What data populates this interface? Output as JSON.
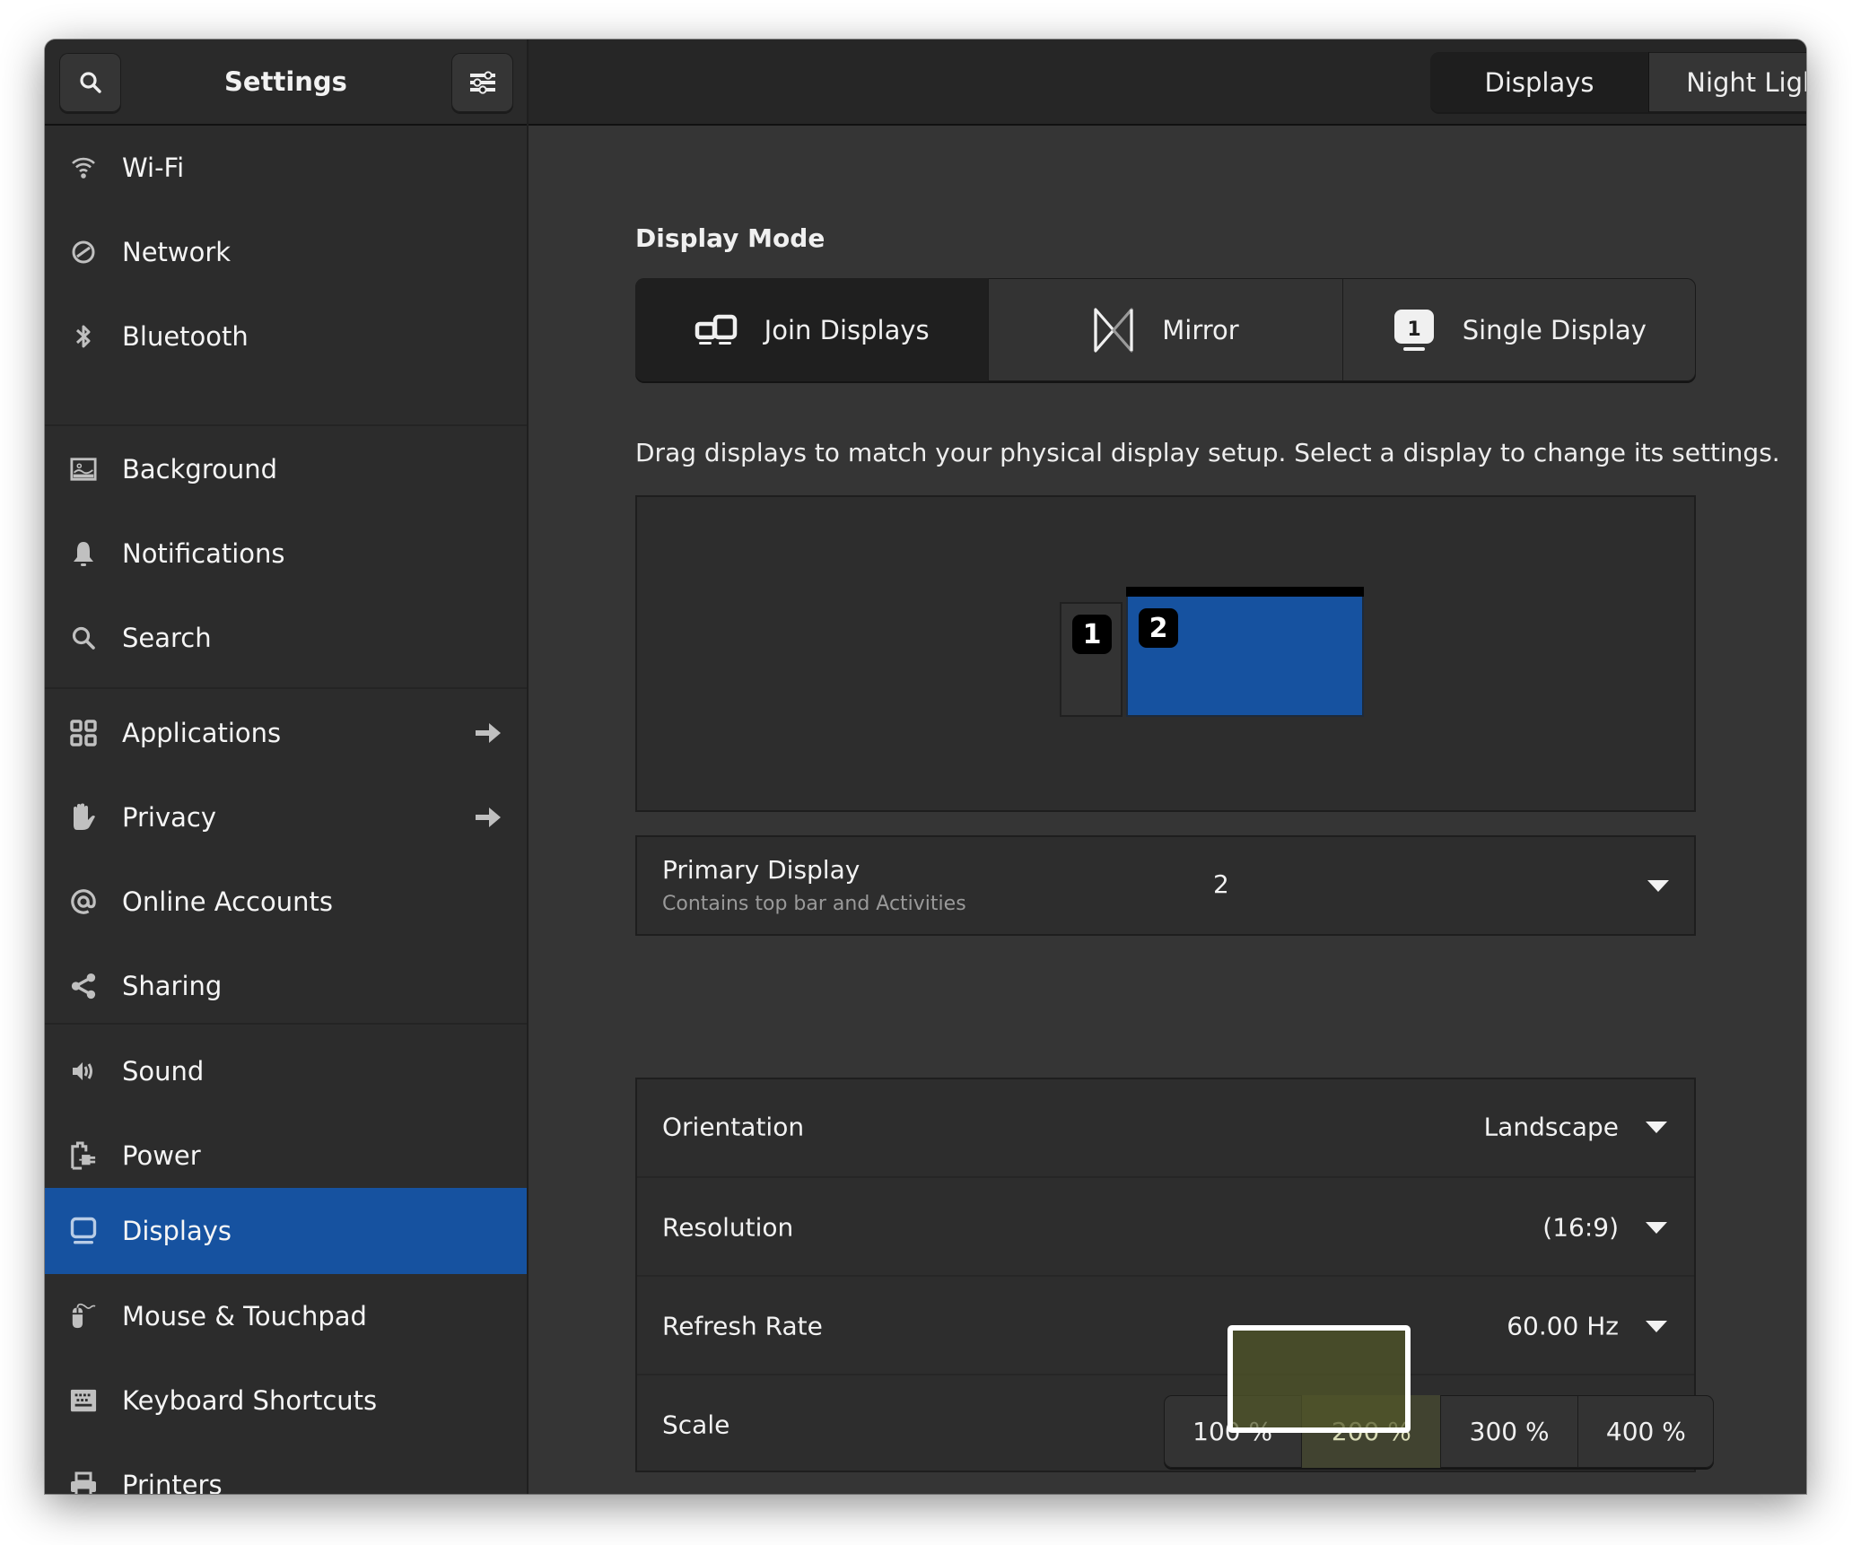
{
  "window": {
    "title": "Settings",
    "search_button_icon": "search-icon",
    "menu_button_icon": "sliders-menu-icon",
    "close_icon": "close-icon"
  },
  "view_switcher": {
    "tabs": [
      {
        "label": "Displays",
        "active": true
      },
      {
        "label": "Night Light",
        "active": false
      }
    ]
  },
  "sidebar": {
    "items": [
      {
        "label": "Wi-Fi",
        "icon": "wifi-icon"
      },
      {
        "label": "Network",
        "icon": "network-icon"
      },
      {
        "label": "Bluetooth",
        "icon": "bluetooth-icon"
      },
      {
        "label": "Background",
        "icon": "image-icon"
      },
      {
        "label": "Notifications",
        "icon": "bell-icon"
      },
      {
        "label": "Search",
        "icon": "search-icon"
      },
      {
        "label": "Applications",
        "icon": "apps-grid-icon",
        "has_arrow": true
      },
      {
        "label": "Privacy",
        "icon": "hand-icon",
        "has_arrow": true
      },
      {
        "label": "Online Accounts",
        "icon": "at-icon"
      },
      {
        "label": "Sharing",
        "icon": "share-icon"
      },
      {
        "label": "Sound",
        "icon": "speaker-icon"
      },
      {
        "label": "Power",
        "icon": "battery-plug-icon"
      },
      {
        "label": "Displays",
        "icon": "monitor-icon",
        "selected": true
      },
      {
        "label": "Mouse & Touchpad",
        "icon": "mouse-icon"
      },
      {
        "label": "Keyboard Shortcuts",
        "icon": "keyboard-icon"
      },
      {
        "label": "Printers",
        "icon": "printer-icon"
      }
    ],
    "selected_color": "#1652a0"
  },
  "main": {
    "display_mode": {
      "title": "Display Mode",
      "options": [
        {
          "label": "Join Displays",
          "icon": "join-displays-icon",
          "active": true
        },
        {
          "label": "Mirror",
          "icon": "mirror-icon",
          "active": false
        },
        {
          "label": "Single Display",
          "icon": "single-display-icon",
          "badge": "1",
          "active": false
        }
      ]
    },
    "hint": "Drag displays to match your physical display setup. Select a display to change its settings.",
    "arrangement": {
      "displays": [
        {
          "number": "1",
          "selected": false
        },
        {
          "number": "2",
          "selected": true,
          "primary": true
        }
      ],
      "selected_color": "#1652a0"
    },
    "primary_display": {
      "label": "Primary Display",
      "subtitle": "Contains top bar and Activities",
      "value": "2"
    },
    "monitor_settings": {
      "orientation": {
        "label": "Orientation",
        "value": "Landscape"
      },
      "resolution": {
        "label": "Resolution",
        "value": "(16:9)"
      },
      "refresh_rate": {
        "label": "Refresh Rate",
        "value": "60.00 Hz"
      },
      "scale": {
        "label": "Scale",
        "options": [
          "100 %",
          "200 %",
          "300 %",
          "400 %"
        ],
        "selected": "200 %"
      }
    }
  }
}
